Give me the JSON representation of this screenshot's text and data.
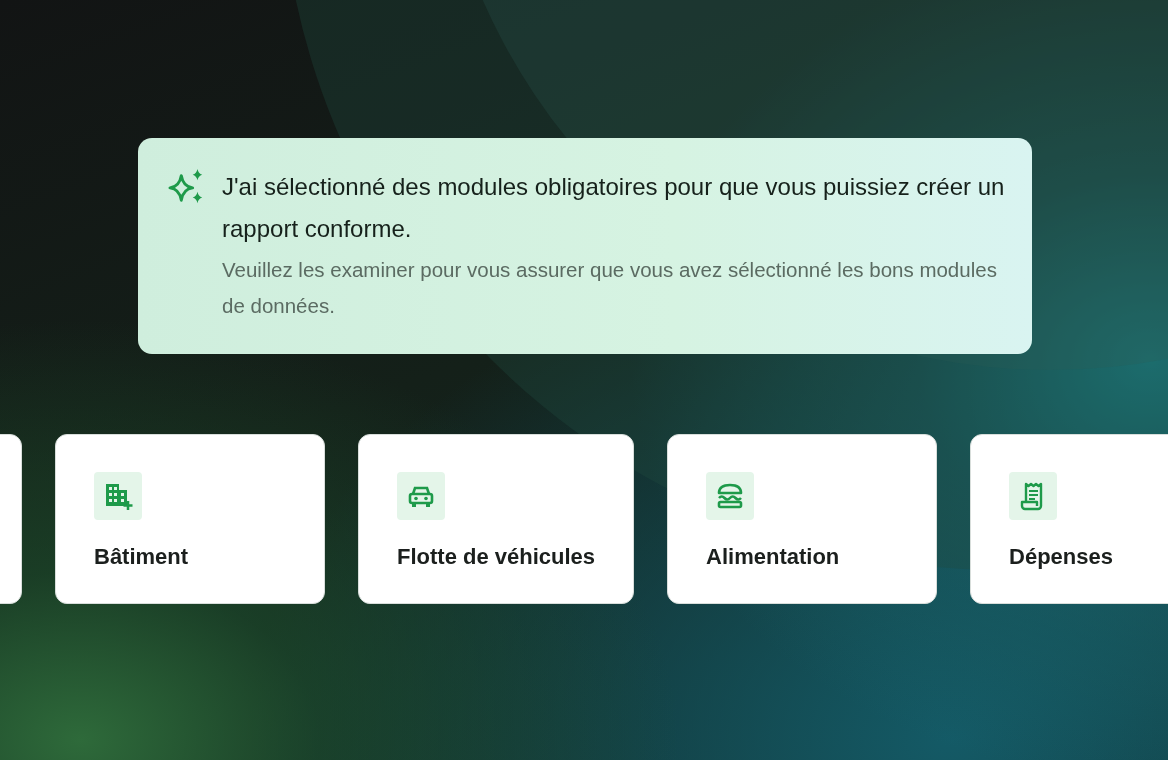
{
  "banner": {
    "title": "J'ai sélectionné des modules obligatoires pour que vous puissiez créer un rapport conforme.",
    "subtitle": "Veuillez les examiner pour vous assurer que vous avez sélectionné les bons modules de données."
  },
  "modules": [
    {
      "kind": "building",
      "label": "Bâtiment"
    },
    {
      "kind": "car",
      "label": "Flotte de véhicules"
    },
    {
      "kind": "burger",
      "label": "Alimentation"
    },
    {
      "kind": "receipt",
      "label": "Dépenses"
    }
  ]
}
